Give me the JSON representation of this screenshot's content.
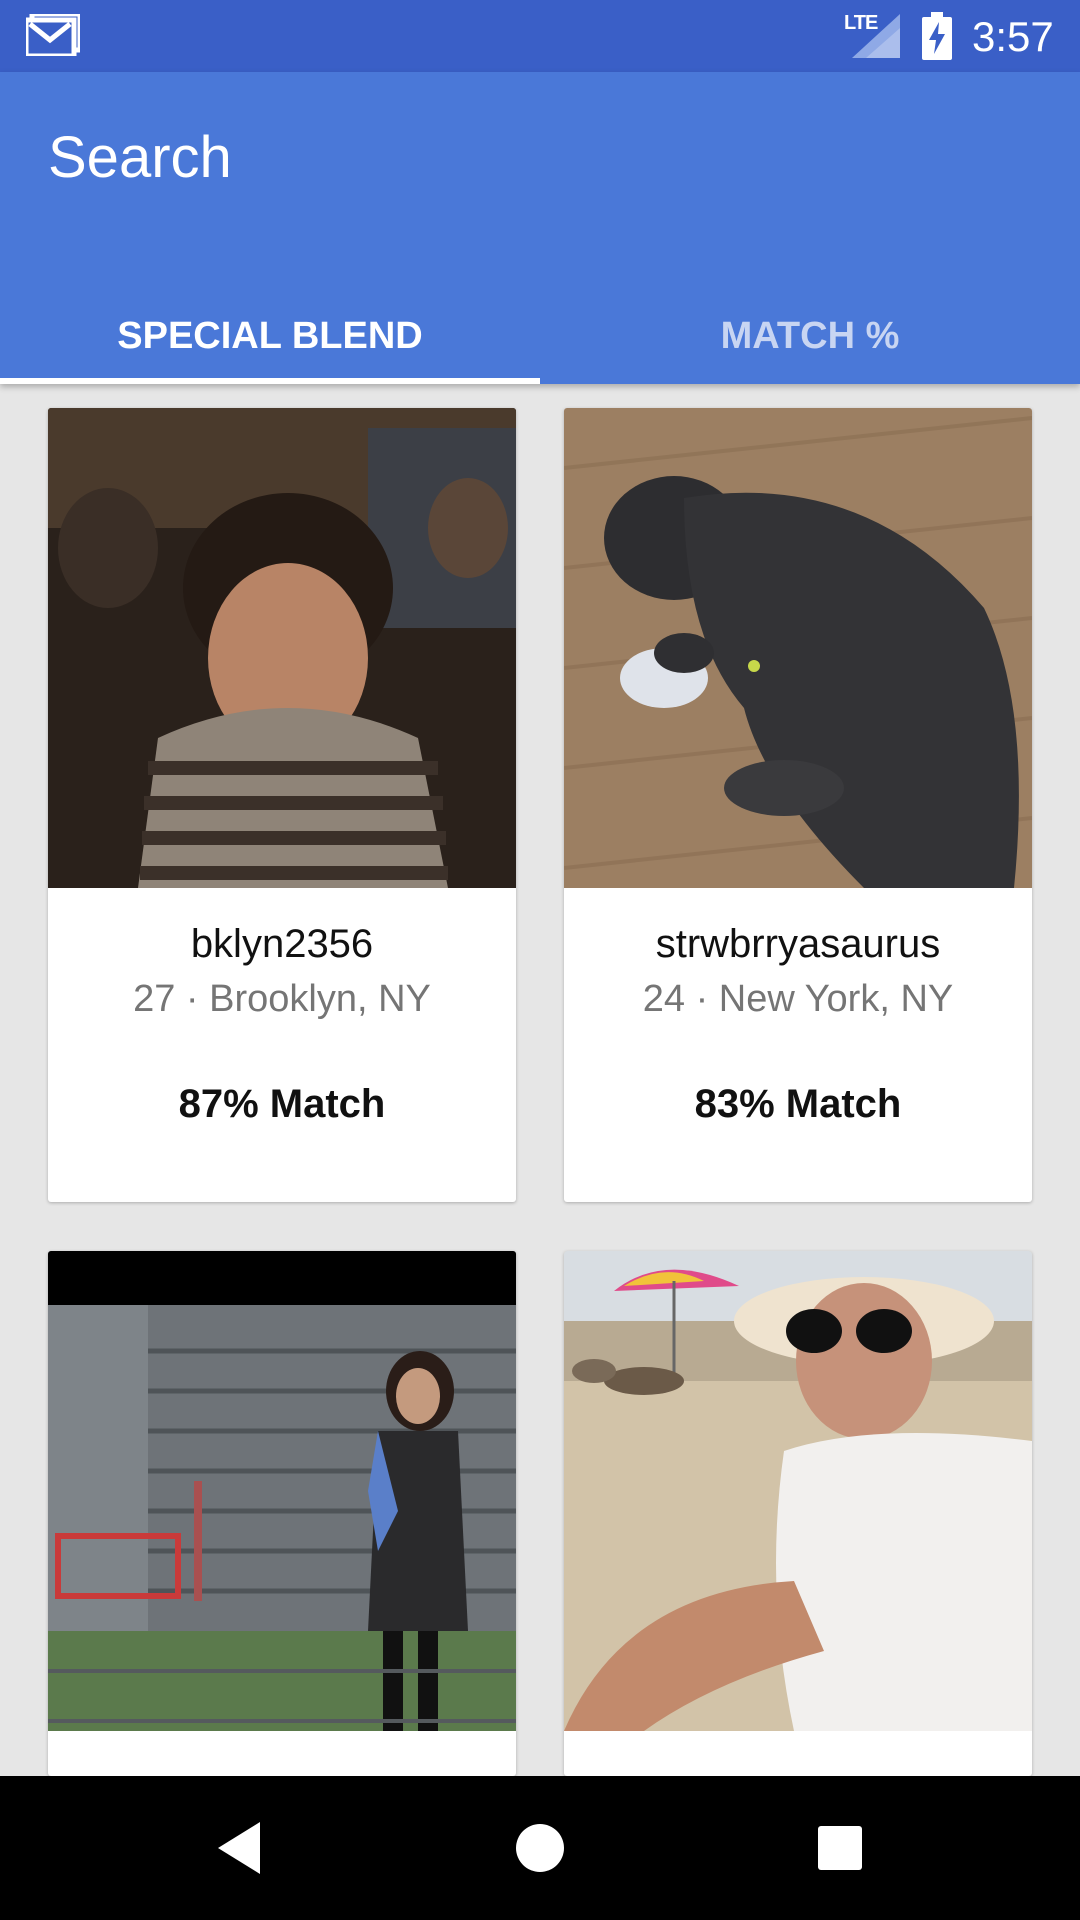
{
  "status_bar": {
    "network": "LTE",
    "time": "3:57",
    "icons": [
      "mail-icon",
      "signal-icon",
      "battery-charging-icon"
    ]
  },
  "app_bar": {
    "title": "Search"
  },
  "tabs": [
    {
      "label": "SPECIAL BLEND",
      "selected": true
    },
    {
      "label": "MATCH %",
      "selected": false
    }
  ],
  "cards": [
    {
      "username": "bklyn2356",
      "meta": "27 · Brooklyn, NY",
      "match": "87% Match"
    },
    {
      "username": "strwbrryasaurus",
      "meta": "24 · New York, NY",
      "match": "83% Match"
    },
    {
      "username": "",
      "meta": "",
      "match": ""
    },
    {
      "username": "",
      "meta": "",
      "match": ""
    }
  ],
  "nav_bar": {
    "icons": [
      "back-icon",
      "home-icon",
      "recents-icon"
    ]
  },
  "colors": {
    "status_bar": "#3a5fc7",
    "app_bar": "#4a78d8",
    "background": "#e6e6e6"
  }
}
